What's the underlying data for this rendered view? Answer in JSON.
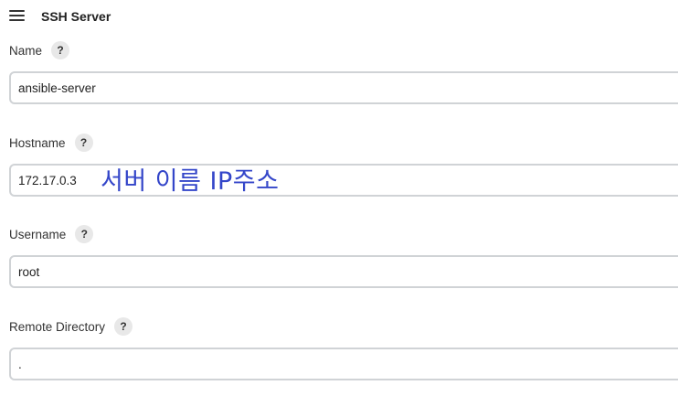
{
  "header": {
    "drag_icon": "hamburger-drag-icon",
    "title": "SSH Server"
  },
  "fields": {
    "name": {
      "label": "Name",
      "help": "?",
      "value": "ansible-server"
    },
    "hostname": {
      "label": "Hostname",
      "help": "?",
      "value": "172.17.0.3"
    },
    "username": {
      "label": "Username",
      "help": "?",
      "value": "root"
    },
    "remote_directory": {
      "label": "Remote Directory",
      "help": "?",
      "value": "."
    }
  },
  "annotation": {
    "text": "서버 이름 IP주소",
    "color": "#3446c9"
  }
}
